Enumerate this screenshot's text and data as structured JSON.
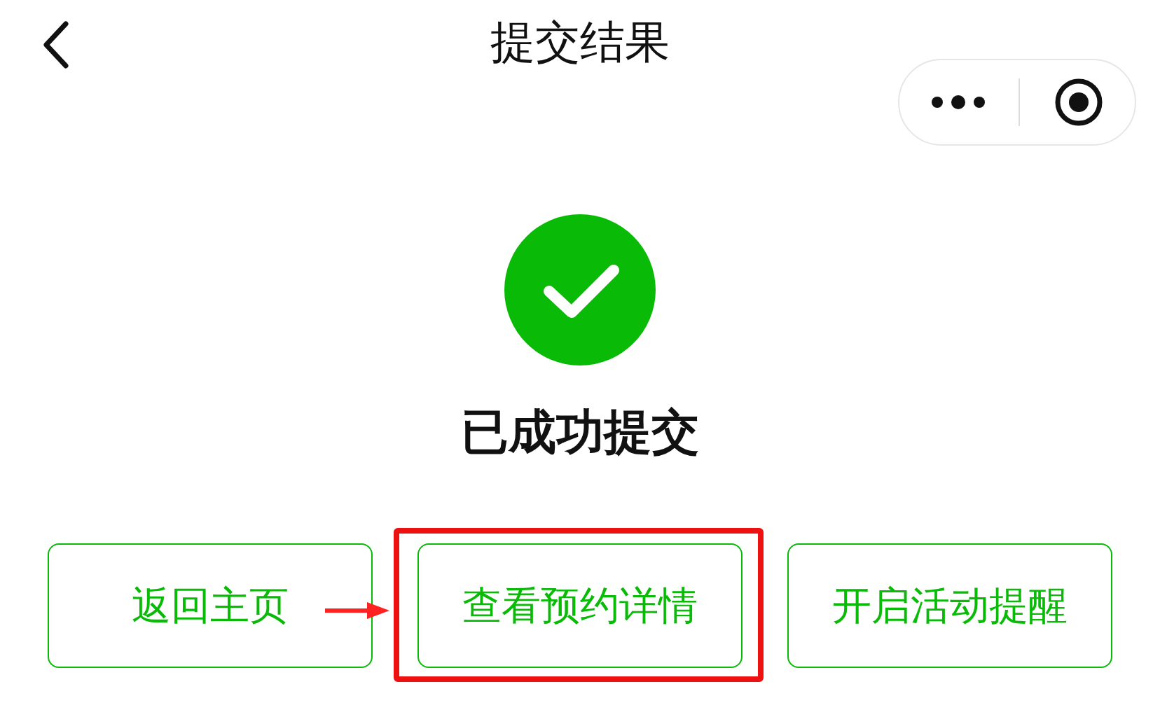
{
  "header": {
    "title": "提交结果"
  },
  "result": {
    "message": "已成功提交"
  },
  "buttons": [
    {
      "label": "返回主页",
      "highlighted": false
    },
    {
      "label": "查看预约详情",
      "highlighted": true
    },
    {
      "label": "开启活动提醒",
      "highlighted": false
    }
  ]
}
